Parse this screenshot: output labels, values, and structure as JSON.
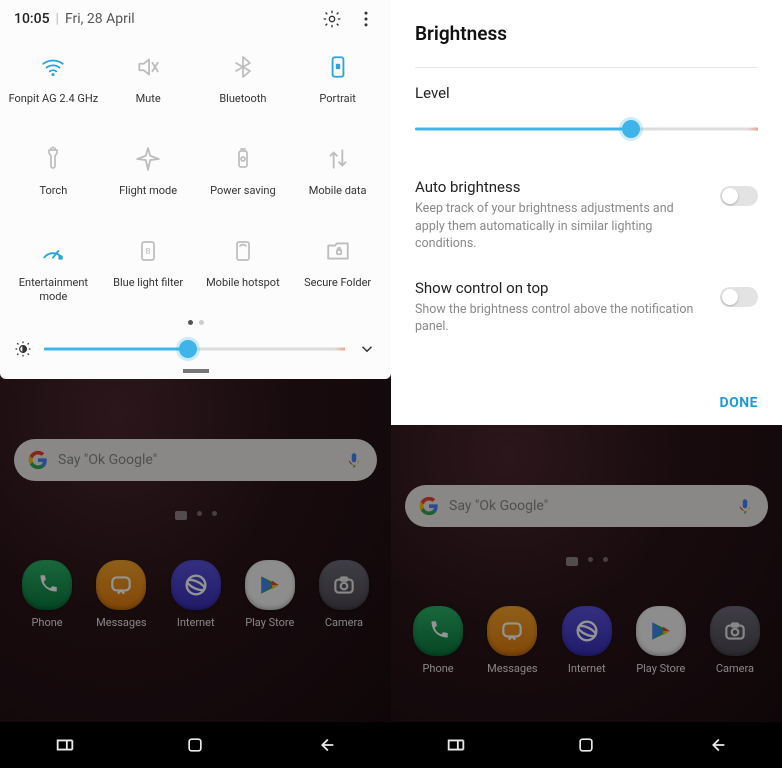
{
  "left": {
    "header": {
      "time": "10:05",
      "date": "Fri, 28 April"
    },
    "tiles": [
      {
        "label": "Fonpit AG 2.4 GHz",
        "icon": "wifi",
        "active": true
      },
      {
        "label": "Mute",
        "icon": "mute",
        "active": false
      },
      {
        "label": "Bluetooth",
        "icon": "bluetooth",
        "active": false
      },
      {
        "label": "Portrait",
        "icon": "portrait",
        "active": true
      },
      {
        "label": "Torch",
        "icon": "torch",
        "active": false
      },
      {
        "label": "Flight mode",
        "icon": "airplane",
        "active": false
      },
      {
        "label": "Power saving",
        "icon": "battery",
        "active": false
      },
      {
        "label": "Mobile data",
        "icon": "mobiledata",
        "active": false
      },
      {
        "label": "Entertainment mode",
        "icon": "gauge",
        "active": true
      },
      {
        "label": "Blue light filter",
        "icon": "bluelight",
        "active": false
      },
      {
        "label": "Mobile hotspot",
        "icon": "hotspot",
        "active": false
      },
      {
        "label": "Secure Folder",
        "icon": "securefolder",
        "active": false
      }
    ],
    "brightness_percent": 48
  },
  "right": {
    "title": "Brightness",
    "level_label": "Level",
    "level_percent": 63,
    "settings": [
      {
        "title": "Auto brightness",
        "desc": "Keep track of your brightness adjustments and apply them automatically in similar lighting conditions.",
        "on": false
      },
      {
        "title": "Show control on top",
        "desc": "Show the brightness control above the notification panel.",
        "on": false
      }
    ],
    "done": "DONE"
  },
  "home": {
    "search_placeholder": "Say \"Ok Google\"",
    "apps": [
      {
        "label": "Phone",
        "color": "c-green"
      },
      {
        "label": "Messages",
        "color": "c-orange"
      },
      {
        "label": "Internet",
        "color": "c-purple"
      },
      {
        "label": "Play Store",
        "color": "c-white"
      },
      {
        "label": "Camera",
        "color": "c-grey"
      }
    ]
  }
}
